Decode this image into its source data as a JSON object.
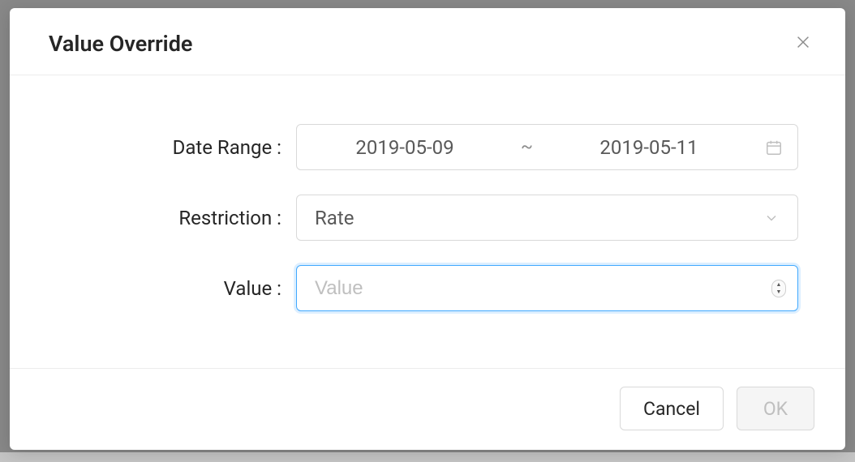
{
  "modal": {
    "title": "Value Override",
    "fields": {
      "dateRange": {
        "label": "Date Range :",
        "start": "2019-05-09",
        "separator": "~",
        "end": "2019-05-11"
      },
      "restriction": {
        "label": "Restriction :",
        "selected": "Rate"
      },
      "value": {
        "label": "Value :",
        "placeholder": "Value",
        "current": ""
      }
    },
    "footer": {
      "cancel": "Cancel",
      "ok": "OK"
    }
  }
}
